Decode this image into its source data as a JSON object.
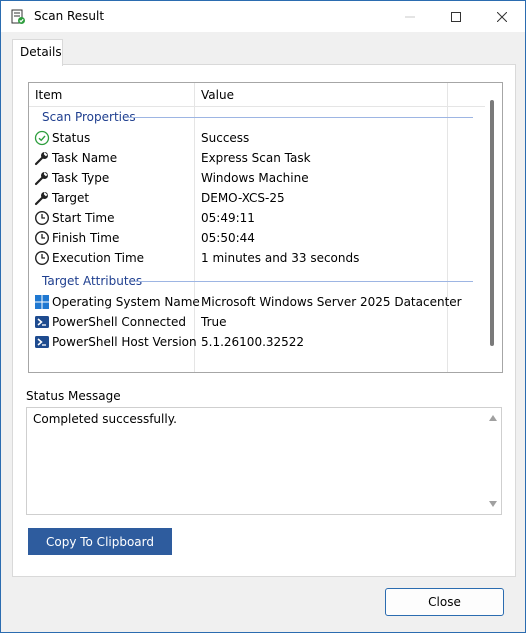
{
  "window": {
    "title": "Scan Result"
  },
  "tabs": [
    {
      "label": "Details"
    }
  ],
  "list": {
    "columns": [
      "Item",
      "Value"
    ],
    "groups": [
      {
        "label": "Scan Properties",
        "rows": [
          {
            "icon": "success-check-icon",
            "name": "Status",
            "value": "Success"
          },
          {
            "icon": "wrench-icon",
            "name": "Task Name",
            "value": "Express Scan Task"
          },
          {
            "icon": "wrench-icon",
            "name": "Task Type",
            "value": "Windows Machine"
          },
          {
            "icon": "wrench-icon",
            "name": "Target",
            "value": "DEMO-XCS-25"
          },
          {
            "icon": "clock-icon",
            "name": "Start Time",
            "value": "05:49:11"
          },
          {
            "icon": "clock-icon",
            "name": "Finish Time",
            "value": "05:50:44"
          },
          {
            "icon": "clock-icon",
            "name": "Execution Time",
            "value": "1 minutes and 33 seconds"
          }
        ]
      },
      {
        "label": "Target Attributes",
        "rows": [
          {
            "icon": "windows-logo-icon",
            "name": "Operating System Name",
            "value": "Microsoft Windows Server 2025 Datacenter"
          },
          {
            "icon": "powershell-icon",
            "name": "PowerShell Connected",
            "value": "True"
          },
          {
            "icon": "powershell-icon",
            "name": "PowerShell Host Version",
            "value": "5.1.26100.32522"
          }
        ]
      }
    ]
  },
  "status": {
    "label": "Status Message",
    "message": "Completed successfully."
  },
  "buttons": {
    "copy": "Copy To Clipboard",
    "close": "Close"
  },
  "colors": {
    "accent": "#2e5c9e",
    "group_text": "#1f3f8f",
    "success": "#2e9e3e"
  }
}
